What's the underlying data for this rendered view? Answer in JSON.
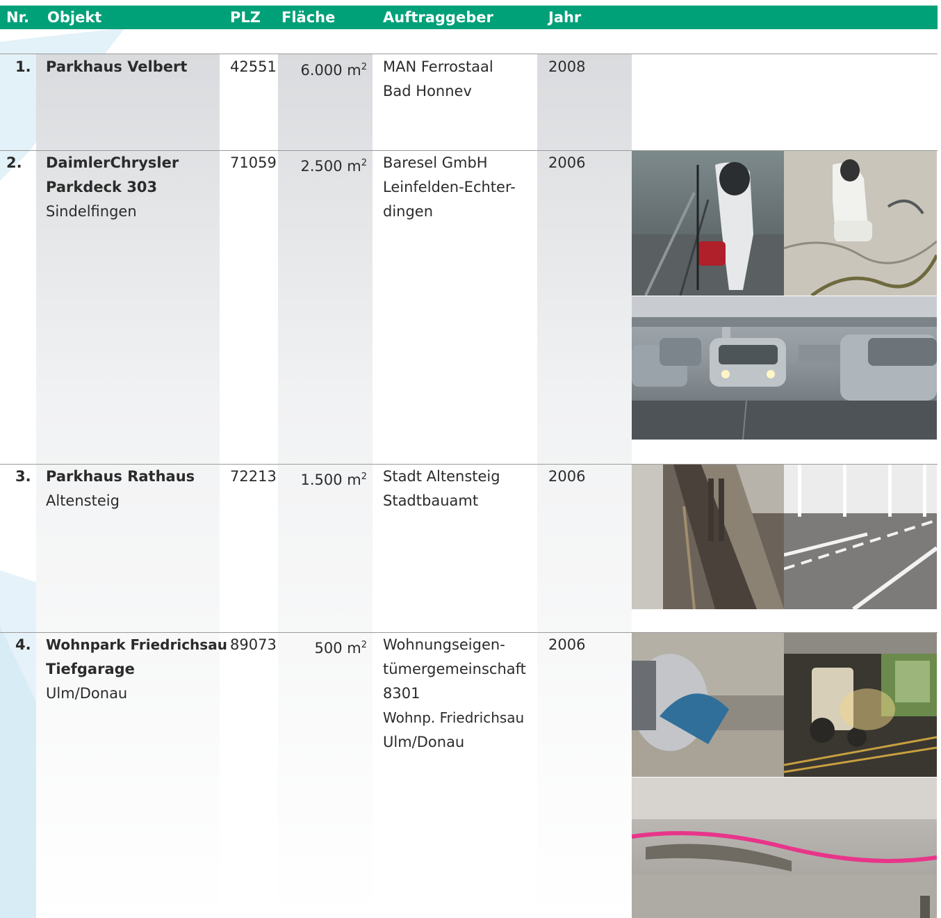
{
  "header": {
    "nr": "Nr.",
    "objekt": "Objekt",
    "plz": "PLZ",
    "flaeche": "Fläche",
    "auftraggeber": "Auftraggeber",
    "jahr": "Jahr"
  },
  "colors": {
    "header_bg": "#00a078",
    "header_text": "#ffffff",
    "accent_light_blue": "#e3f1f8"
  },
  "rows": [
    {
      "nr": "1.",
      "objekt_bold": [
        "Parkhaus Velbert"
      ],
      "objekt_normal": [],
      "plz": "42551",
      "flaeche": "6.000 m",
      "flaeche_sup": "2",
      "auftraggeber": [
        "MAN Ferrostaal",
        "Bad Honnev"
      ],
      "jahr": "2008"
    },
    {
      "nr": "2.",
      "objekt_bold": [
        "DaimlerChrysler",
        "Parkdeck 303"
      ],
      "objekt_normal": [
        "Sindelfingen"
      ],
      "plz": "71059",
      "flaeche": "2.500 m",
      "flaeche_sup": "2",
      "auftraggeber": [
        "Baresel GmbH",
        "Leinfelden-Echter-",
        "dingen"
      ],
      "jahr": "2006"
    },
    {
      "nr": "3.",
      "objekt_bold": [
        "Parkhaus Rathaus"
      ],
      "objekt_normal": [
        "Altensteig"
      ],
      "plz": "72213",
      "flaeche": "1.500 m",
      "flaeche_sup": "2",
      "auftraggeber": [
        "Stadt Altensteig",
        "Stadtbauamt"
      ],
      "jahr": "2006"
    },
    {
      "nr": "4.",
      "objekt_bold": [
        "Wohnpark Friedrichsau",
        "Tiefgarage"
      ],
      "objekt_normal": [
        "Ulm/Donau"
      ],
      "plz": "89073",
      "flaeche": "500 m",
      "flaeche_sup": "2",
      "auftraggeber": [
        "Wohnungseigen-",
        "tümergemeinschaft",
        "8301",
        "Wohnp. Friedrichsau",
        "Ulm/Donau"
      ],
      "jahr": "2006"
    }
  ],
  "photos": [
    {
      "name": "worker-blasting-photo"
    },
    {
      "name": "worker-crack-repair-photo"
    },
    {
      "name": "parking-deck-cars-photo"
    },
    {
      "name": "drainage-channel-photo"
    },
    {
      "name": "coated-parking-floor-photo"
    },
    {
      "name": "floor-saw-photo"
    },
    {
      "name": "garage-machine-photo"
    },
    {
      "name": "concrete-beam-repair-photo"
    }
  ]
}
